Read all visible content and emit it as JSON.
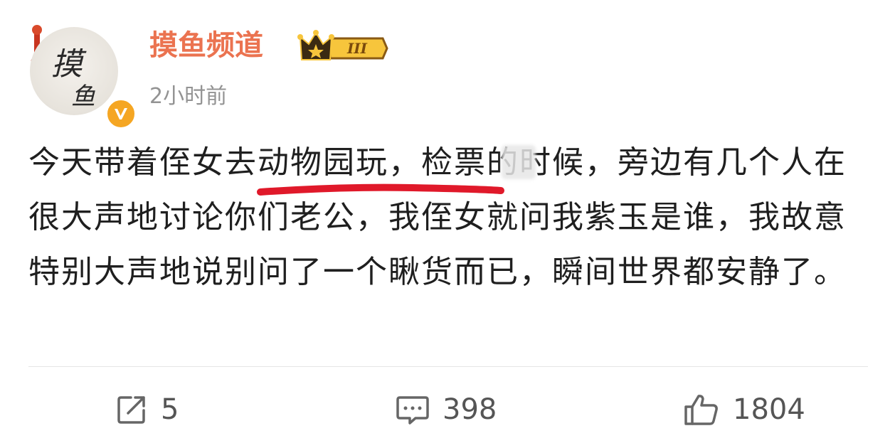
{
  "post": {
    "author": "摸鱼频道",
    "avatar_text_1": "摸",
    "avatar_text_2": "鱼",
    "vip_level": "III",
    "time": "2小时前",
    "content": "今天带着侄女去动物园玩，检票的时候，旁边有几个人在很大声地讨论你们老公，我侄女就问我紫玉是谁，我故意特别大声地说别问了一个瞅货而已，瞬间世界都安静了。"
  },
  "actions": {
    "repost_count": "5",
    "comment_count": "398",
    "like_count": "1804"
  },
  "colors": {
    "username": "#eb7350",
    "annotation_line": "#e0192a",
    "meta": "#939393",
    "icon": "#666666"
  },
  "icons": {
    "repost": "share-arrow-icon",
    "comment": "comment-bubble-icon",
    "like": "thumbs-up-icon",
    "verified": "verified-v-icon",
    "vip": "crown-icon"
  }
}
